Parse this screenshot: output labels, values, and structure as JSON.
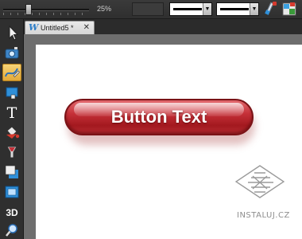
{
  "toolbar": {
    "zoom_percent": "25%",
    "line_style_combo": "line-style-selector",
    "line_width_combo": "line-width-selector",
    "icons": [
      "pen-icon",
      "color-grid-icon"
    ]
  },
  "tools": [
    {
      "name": "selector-tool-icon"
    },
    {
      "name": "photo-tool-icon"
    },
    {
      "name": "freehand-tool-icon",
      "active": true
    },
    {
      "name": "rectangle-tool-icon"
    },
    {
      "name": "text-tool-icon",
      "glyph": "T"
    },
    {
      "name": "fill-tool-icon"
    },
    {
      "name": "transparency-tool-icon"
    },
    {
      "name": "shadow-tool-icon"
    },
    {
      "name": "bevel-tool-icon"
    },
    {
      "name": "3d-tool-icon",
      "glyph": "3D"
    },
    {
      "name": "zoom-tool-icon"
    }
  ],
  "document_tab": {
    "app_logo": "W",
    "title": "Untitled5 *",
    "close": "✕"
  },
  "canvas": {
    "button_text": "Button Text"
  },
  "watermark": {
    "text": "INSTALUJ.CZ"
  },
  "colors": {
    "accent_active_tool": "#f0c050",
    "button_red": "#c53038",
    "button_border": "#7a1216",
    "ui_dark": "#2f2f2f"
  }
}
